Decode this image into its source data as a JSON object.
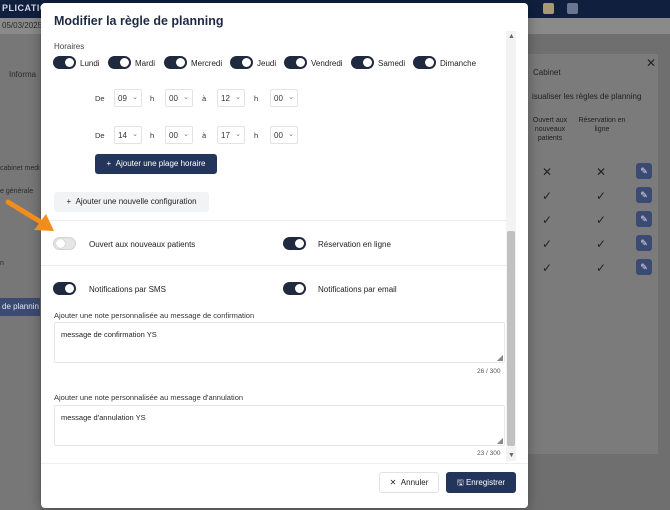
{
  "background": {
    "app_name": "PLICATIO",
    "date": "05/03/2025",
    "left_info": "Informa",
    "left_rows": [
      "cabinet medi",
      "e générale",
      "n"
    ],
    "left_button": "de plannin",
    "panel_title": "Cabinet",
    "panel_subtitle": "isualiser les règles de planning",
    "panel_col1": "Ouvert aux nouveaux patients",
    "panel_col2": "Réservation en ligne",
    "panel_rows": [
      {
        "c1": "✕",
        "c2": "✕"
      },
      {
        "c1": "✓",
        "c2": "✓"
      },
      {
        "c1": "✓",
        "c2": "✓"
      },
      {
        "c1": "✓",
        "c2": "✓"
      },
      {
        "c1": "✓",
        "c2": "✓"
      }
    ]
  },
  "modal": {
    "title": "Modifier la règle de planning",
    "section_hours": "Horaires",
    "days": [
      {
        "label": "Lundi",
        "on": true
      },
      {
        "label": "Mardi",
        "on": true
      },
      {
        "label": "Mercredi",
        "on": true
      },
      {
        "label": "Jeudi",
        "on": true
      },
      {
        "label": "Vendredi",
        "on": true
      },
      {
        "label": "Samedi",
        "on": true
      },
      {
        "label": "Dimanche",
        "on": true
      }
    ],
    "time_ranges": [
      {
        "from_label": "De",
        "from_h": "09",
        "h1": "h",
        "from_m": "00",
        "to_label": "à",
        "to_h": "12",
        "h2": "h",
        "to_m": "00"
      },
      {
        "from_label": "De",
        "from_h": "14",
        "h1": "h",
        "from_m": "00",
        "to_label": "à",
        "to_h": "17",
        "h2": "h",
        "to_m": "00"
      }
    ],
    "add_slot_label": "Ajouter une plage horaire",
    "add_config_label": "Ajouter une nouvelle configuration",
    "options": {
      "new_patients": {
        "label": "Ouvert aux nouveaux patients",
        "on": false
      },
      "online_booking": {
        "label": "Réservation en ligne",
        "on": true
      },
      "sms": {
        "label": "Notifications par SMS",
        "on": true
      },
      "email": {
        "label": "Notifications par email",
        "on": true
      }
    },
    "confirmation_note": {
      "label": "Ajouter une note personnalisée au message de confirmation",
      "value": "message de confirmation YS",
      "counter": "26 / 300"
    },
    "cancellation_note": {
      "label": "Ajouter une note personnalisée au message d'annulation",
      "value": "message d'annulation YS",
      "counter": "23 / 300"
    },
    "cancel_label": "Annuler",
    "save_label": "Enregistrer"
  },
  "colors": {
    "primary": "#24355b",
    "toggle_on": "#1f2a3f",
    "annotation_arrow": "#f28c1b"
  }
}
